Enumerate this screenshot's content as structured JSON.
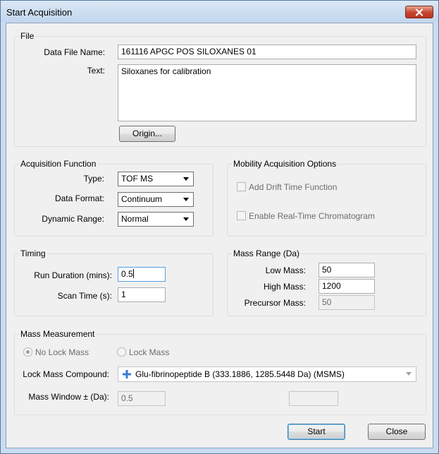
{
  "window": {
    "title": "Start Acquisition"
  },
  "file": {
    "legend": "File",
    "data_file_name_label": "Data File Name:",
    "data_file_name_value": "161116 APGC POS SILOXANES 01",
    "text_label": "Text:",
    "text_value": "Siloxanes for calibration",
    "origin_button": "Origin..."
  },
  "acquisition_function": {
    "legend": "Acquisition Function",
    "type_label": "Type:",
    "type_value": "TOF MS",
    "data_format_label": "Data Format:",
    "data_format_value": "Continuum",
    "dynamic_range_label": "Dynamic Range:",
    "dynamic_range_value": "Normal"
  },
  "mobility": {
    "legend": "Mobility Acquisition Options",
    "add_drift_time": "Add Drift Time Function",
    "enable_realtime": "Enable Real-Time Chromatogram"
  },
  "timing": {
    "legend": "Timing",
    "run_duration_label": "Run Duration (mins):",
    "run_duration_value": "0.5",
    "scan_time_label": "Scan Time (s):",
    "scan_time_value": "1"
  },
  "mass_range": {
    "legend": "Mass Range (Da)",
    "low_mass_label": "Low Mass:",
    "low_mass_value": "50",
    "high_mass_label": "High Mass:",
    "high_mass_value": "1200",
    "precursor_mass_label": "Precursor Mass:",
    "precursor_mass_value": "50"
  },
  "mass_measurement": {
    "legend": "Mass Measurement",
    "no_lock_mass": "No Lock Mass",
    "lock_mass": "Lock Mass",
    "lock_mass_compound_label": "Lock Mass Compound:",
    "lock_mass_compound_value": "Glu-fibrinopeptide B (333.1886, 1285.5448 Da) (MSMS)",
    "mass_window_label": "Mass Window ± (Da):",
    "mass_window_value": "0.5"
  },
  "buttons": {
    "start": "Start",
    "close": "Close"
  },
  "colors": {
    "title_bar": "#c9dcf0",
    "close_button": "#c7452f",
    "plus_icon": "#3a7bd5"
  }
}
